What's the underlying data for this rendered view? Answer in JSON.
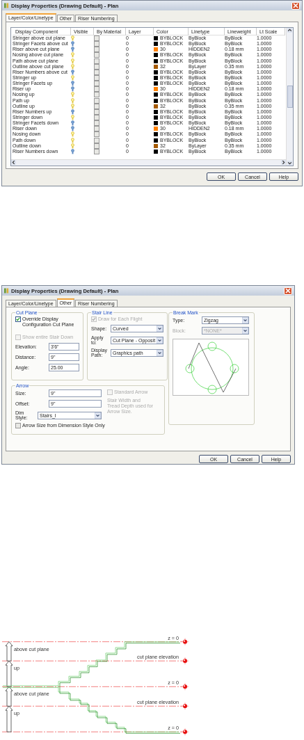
{
  "layer_dialog": {
    "title": "Display Properties (Drawing Default) - Plan",
    "tabs": [
      {
        "label": "Layer/Color/Linetype",
        "selected": true
      },
      {
        "label": "Other",
        "selected": false
      },
      {
        "label": "Riser Numbering",
        "selected": false
      }
    ],
    "table": {
      "columns": [
        "Display Component",
        "Visible",
        "By Material",
        "Layer",
        "Color",
        "Linetype",
        "Lineweight",
        "Lt Scale"
      ],
      "rows": [
        {
          "component": "Stringer above cut plane",
          "visible": true,
          "by_material": false,
          "layer": "0",
          "color": "#000000",
          "color_label": "BYBLOCK",
          "linetype": "ByBlock",
          "lineweight": "ByBlock",
          "lt_scale": "1.0000"
        },
        {
          "component": "Stringer Facets above cut",
          "visible": false,
          "by_material": false,
          "layer": "0",
          "color": "#000000",
          "color_label": "BYBLOCK",
          "linetype": "ByBlock",
          "lineweight": "ByBlock",
          "lt_scale": "1.0000"
        },
        {
          "component": "Riser above cut plane",
          "visible": false,
          "by_material": false,
          "layer": "0",
          "color": "#ff8000",
          "color_label": "30",
          "linetype": "HIDDEN2",
          "lineweight": "0.18 mm",
          "lt_scale": "1.0000"
        },
        {
          "component": "Nosing above cut plane",
          "visible": true,
          "by_material": false,
          "layer": "0",
          "color": "#000000",
          "color_label": "BYBLOCK",
          "linetype": "ByBlock",
          "lineweight": "ByBlock",
          "lt_scale": "1.0000"
        },
        {
          "component": "Path above cut plane",
          "visible": true,
          "by_material": false,
          "layer": "0",
          "color": "#000000",
          "color_label": "BYBLOCK",
          "linetype": "ByBlock",
          "lineweight": "ByBlock",
          "lt_scale": "1.0000"
        },
        {
          "component": "Outline above cut plane",
          "visible": true,
          "by_material": false,
          "layer": "0",
          "color": "#a55a00",
          "color_label": "32",
          "linetype": "ByLayer",
          "lineweight": "0.35 mm",
          "lt_scale": "1.0000"
        },
        {
          "component": "Riser Numbers above cut",
          "visible": false,
          "by_material": false,
          "layer": "0",
          "color": "#000000",
          "color_label": "BYBLOCK",
          "linetype": "ByBlock",
          "lineweight": "ByBlock",
          "lt_scale": "1.0000"
        },
        {
          "component": "Stringer up",
          "visible": true,
          "by_material": false,
          "layer": "0",
          "color": "#000000",
          "color_label": "BYBLOCK",
          "linetype": "ByBlock",
          "lineweight": "ByBlock",
          "lt_scale": "1.0000"
        },
        {
          "component": "Stringer Facets up",
          "visible": false,
          "by_material": false,
          "layer": "0",
          "color": "#000000",
          "color_label": "BYBLOCK",
          "linetype": "ByBlock",
          "lineweight": "ByBlock",
          "lt_scale": "1.0000"
        },
        {
          "component": "Riser up",
          "visible": false,
          "by_material": false,
          "layer": "0",
          "color": "#ff8000",
          "color_label": "30",
          "linetype": "HIDDEN2",
          "lineweight": "0.18 mm",
          "lt_scale": "1.0000"
        },
        {
          "component": "Nosing up",
          "visible": true,
          "by_material": false,
          "layer": "0",
          "color": "#000000",
          "color_label": "BYBLOCK",
          "linetype": "ByBlock",
          "lineweight": "ByBlock",
          "lt_scale": "1.0000"
        },
        {
          "component": "Path up",
          "visible": true,
          "by_material": false,
          "layer": "0",
          "color": "#000000",
          "color_label": "BYBLOCK",
          "linetype": "ByBlock",
          "lineweight": "ByBlock",
          "lt_scale": "1.0000"
        },
        {
          "component": "Outline up",
          "visible": true,
          "by_material": false,
          "layer": "0",
          "color": "#a55a00",
          "color_label": "32",
          "linetype": "ByBlock",
          "lineweight": "0.35 mm",
          "lt_scale": "1.0000"
        },
        {
          "component": "Riser Numbers up",
          "visible": false,
          "by_material": false,
          "layer": "0",
          "color": "#000000",
          "color_label": "BYBLOCK",
          "linetype": "ByBlock",
          "lineweight": "ByBlock",
          "lt_scale": "1.0000"
        },
        {
          "component": "Stringer down",
          "visible": true,
          "by_material": false,
          "layer": "0",
          "color": "#000000",
          "color_label": "BYBLOCK",
          "linetype": "ByBlock",
          "lineweight": "ByBlock",
          "lt_scale": "1.0000"
        },
        {
          "component": "Stringer Facets down",
          "visible": false,
          "by_material": false,
          "layer": "0",
          "color": "#000000",
          "color_label": "BYBLOCK",
          "linetype": "ByBlock",
          "lineweight": "ByBlock",
          "lt_scale": "1.0000"
        },
        {
          "component": "Riser down",
          "visible": false,
          "by_material": false,
          "layer": "0",
          "color": "#ff8000",
          "color_label": "30",
          "linetype": "HIDDEN2",
          "lineweight": "0.18 mm",
          "lt_scale": "1.0000"
        },
        {
          "component": "Nosing down",
          "visible": true,
          "by_material": false,
          "layer": "0",
          "color": "#000000",
          "color_label": "BYBLOCK",
          "linetype": "ByBlock",
          "lineweight": "ByBlock",
          "lt_scale": "1.0000"
        },
        {
          "component": "Path down",
          "visible": true,
          "by_material": false,
          "layer": "0",
          "color": "#000000",
          "color_label": "BYBLOCK",
          "linetype": "ByBlock",
          "lineweight": "ByBlock",
          "lt_scale": "1.0000"
        },
        {
          "component": "Outline down",
          "visible": true,
          "by_material": false,
          "layer": "0",
          "color": "#a55a00",
          "color_label": "32",
          "linetype": "ByLayer",
          "lineweight": "0.35 mm",
          "lt_scale": "1.0000"
        },
        {
          "component": "Riser Numbers down",
          "visible": false,
          "by_material": false,
          "layer": "0",
          "color": "#000000",
          "color_label": "BYBLOCK",
          "linetype": "ByBlock",
          "lineweight": "ByBlock",
          "lt_scale": "1.0000"
        }
      ]
    },
    "buttons": [
      "OK",
      "Cancel",
      "Help"
    ]
  },
  "other_dialog": {
    "title": "Display Properties (Drawing Default) - Plan",
    "tabs": [
      {
        "label": "Layer/Color/Linetype",
        "selected": false
      },
      {
        "label": "Other",
        "selected": true
      },
      {
        "label": "Riser Numbering",
        "selected": false
      }
    ],
    "cut_plane": {
      "title": "Cut Plane",
      "override": {
        "label": "Override Display Configuration Cut Plane",
        "checked": true,
        "disabled": false
      },
      "show_entire": {
        "label": "Show entire Stair Down",
        "checked": false,
        "disabled": true
      },
      "fields": [
        {
          "label": "Elevation:",
          "value": "3'6\""
        },
        {
          "label": "Distance:",
          "value": "9\""
        },
        {
          "label": "Angle:",
          "value": "25.00"
        }
      ]
    },
    "stair_line": {
      "title": "Stair Line",
      "draw_each": {
        "label": "Draw for Each Flight",
        "checked": true,
        "disabled": true
      },
      "dropdowns": [
        {
          "label": "Shape:",
          "value": "Curved"
        },
        {
          "label": "Apply to:",
          "value": "Cut Plane - Opposit"
        },
        {
          "label": "Display Path:",
          "value": "Graphics path"
        }
      ]
    },
    "break_mark": {
      "title": "Break Mark",
      "dropdowns": [
        {
          "label": "Type:",
          "value": "Zigzag",
          "disabled": false
        },
        {
          "label": "Block:",
          "value": "*NONE*",
          "disabled": true
        }
      ]
    },
    "arrow": {
      "title": "Arrow",
      "fields": [
        {
          "label": "Size:",
          "value": "9\""
        },
        {
          "label": "Offset:",
          "value": "9\""
        }
      ],
      "dim_style": {
        "label": "Dim Style:",
        "value": "Stairs_I"
      },
      "standard_arrow": {
        "label": "Standard Arrow",
        "checked": false,
        "disabled": true
      },
      "note": "Stair Width and Tread Depth used for Arrow Size.",
      "size_from_dim": {
        "label": "Arrow Size from Dimension Style Only",
        "checked": false,
        "disabled": false
      }
    },
    "buttons": [
      "OK",
      "Cancel",
      "Help"
    ]
  },
  "diagram": {
    "arrow_labels": [
      "above cut plane",
      "up",
      "above cut plane",
      "up"
    ],
    "level_labels": [
      "z = 0",
      "cut plane elevation",
      "z = 0",
      "cut plane elevation",
      "z = 0"
    ]
  }
}
